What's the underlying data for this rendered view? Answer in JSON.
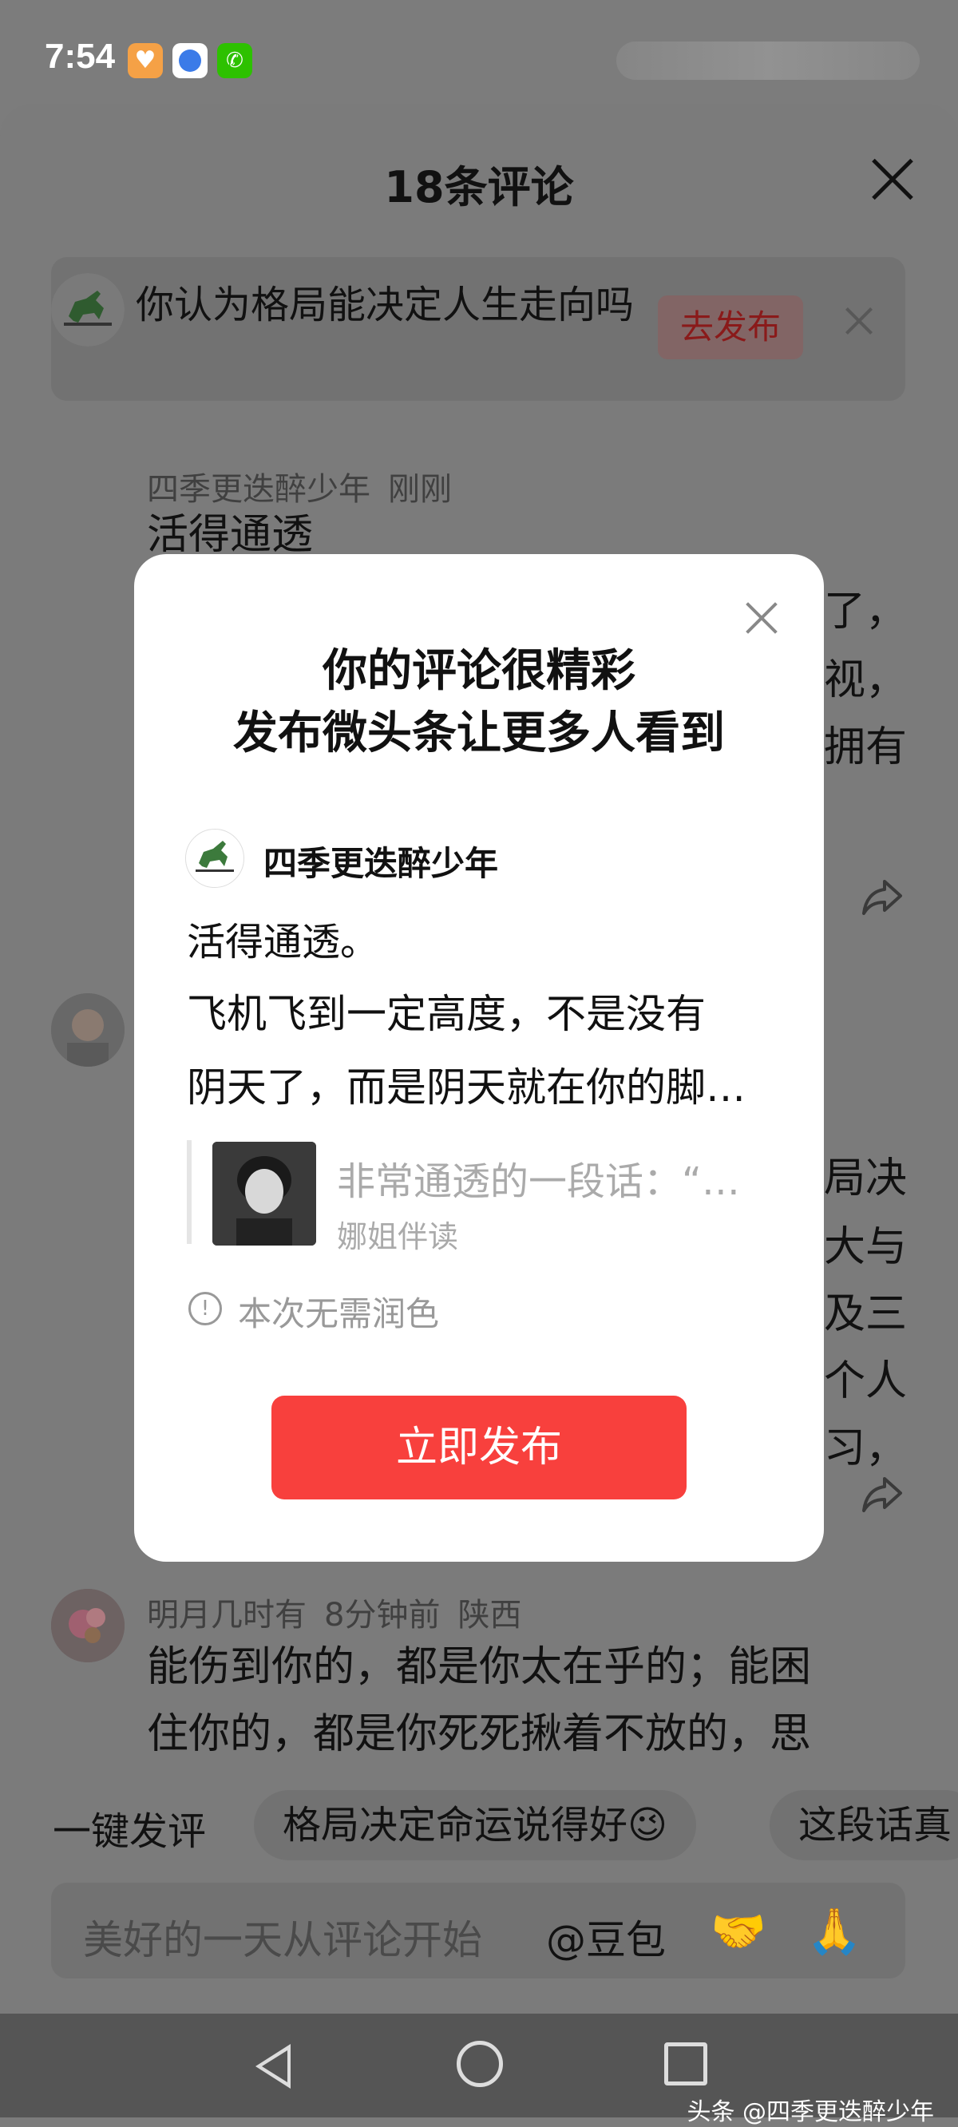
{
  "status_bar": {
    "time": "7:54",
    "icons": [
      "heart-app-icon",
      "browser-icon",
      "wechat-icon"
    ]
  },
  "sheet": {
    "title": "18条评论",
    "topic": {
      "text": "你认为格局能决定人生走向吗",
      "button": "去发布"
    },
    "comments": [
      {
        "author": "四季更迭醉少年",
        "time": "刚刚",
        "text_visible": "活得通透"
      },
      {
        "author": "明月几时有",
        "time": "8分钟前",
        "location": "陕西",
        "text_line1": "能伤到你的，都是你太在乎的；能困",
        "text_line2": "住你的，都是你死死揪着不放的，思"
      }
    ],
    "background_fragments": [
      "天了，",
      "视，",
      "拥有",
      "局决",
      "大与",
      "及三",
      "个人",
      "习，"
    ],
    "quick_reply": {
      "label": "一键发评",
      "chips": [
        "格局决定命运说得好😉",
        "这段话真"
      ]
    },
    "input": {
      "placeholder": "美好的一天从评论开始",
      "mention": "@豆包",
      "emojis": [
        "🤝",
        "🙏"
      ]
    }
  },
  "modal": {
    "title_line1": "你的评论很精彩",
    "title_line2": "发布微头条让更多人看到",
    "post": {
      "author": "四季更迭醉少年",
      "line1": "活得通透。",
      "line2": "飞机飞到一定高度，不是没有",
      "line3": "阴天了，而是阴天就在你的脚…"
    },
    "reference": {
      "title": "非常通透的一段话：“…",
      "source": "娜姐伴读"
    },
    "notice": "本次无需润色",
    "publish_button": "立即发布"
  },
  "watermark": "头条 @四季更迭醉少年",
  "colors": {
    "publish_red": "#f8403d",
    "overlay_gray": "#7b7b7b"
  }
}
